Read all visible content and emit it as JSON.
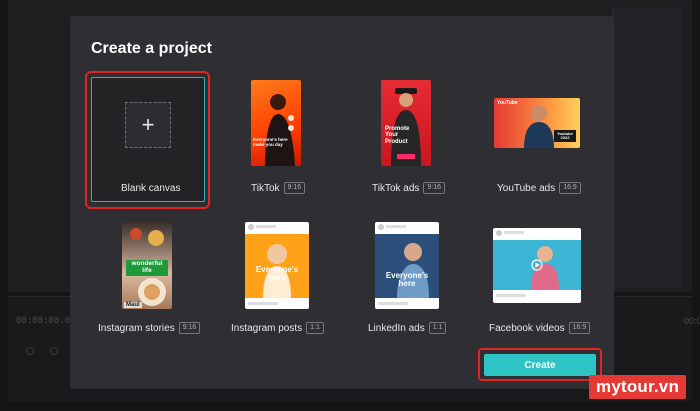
{
  "background": {
    "timecode": "00:00:00.00",
    "timecode_right": "00:0"
  },
  "modal": {
    "title": "Create a project",
    "templates": [
      {
        "name": "Blank canvas",
        "ratio": ""
      },
      {
        "name": "TikTok",
        "ratio": "9:16",
        "thumb_text": "Everyone's here make you day"
      },
      {
        "name": "TikTok ads",
        "ratio": "9:16",
        "thumb_text": "Promote Your Product"
      },
      {
        "name": "YouTube ads",
        "ratio": "16:9",
        "thumb_text": "Youtube 2022",
        "thumb_brand": "YouTube"
      },
      {
        "name": "Instagram stories",
        "ratio": "9:16",
        "thumb_text": "wonderful life",
        "thumb_tag": "Maul"
      },
      {
        "name": "Instagram posts",
        "ratio": "1:1",
        "thumb_text": "Everyone's here"
      },
      {
        "name": "LinkedIn ads",
        "ratio": "1:1",
        "thumb_text": "Everyone's here"
      },
      {
        "name": "Facebook videos",
        "ratio": "16:9"
      }
    ],
    "create_label": "Create"
  },
  "watermark": "mytour.vn",
  "colors": {
    "accent": "#2fc4c4",
    "highlight": "#e02424",
    "modal_bg": "#2f2f33"
  }
}
